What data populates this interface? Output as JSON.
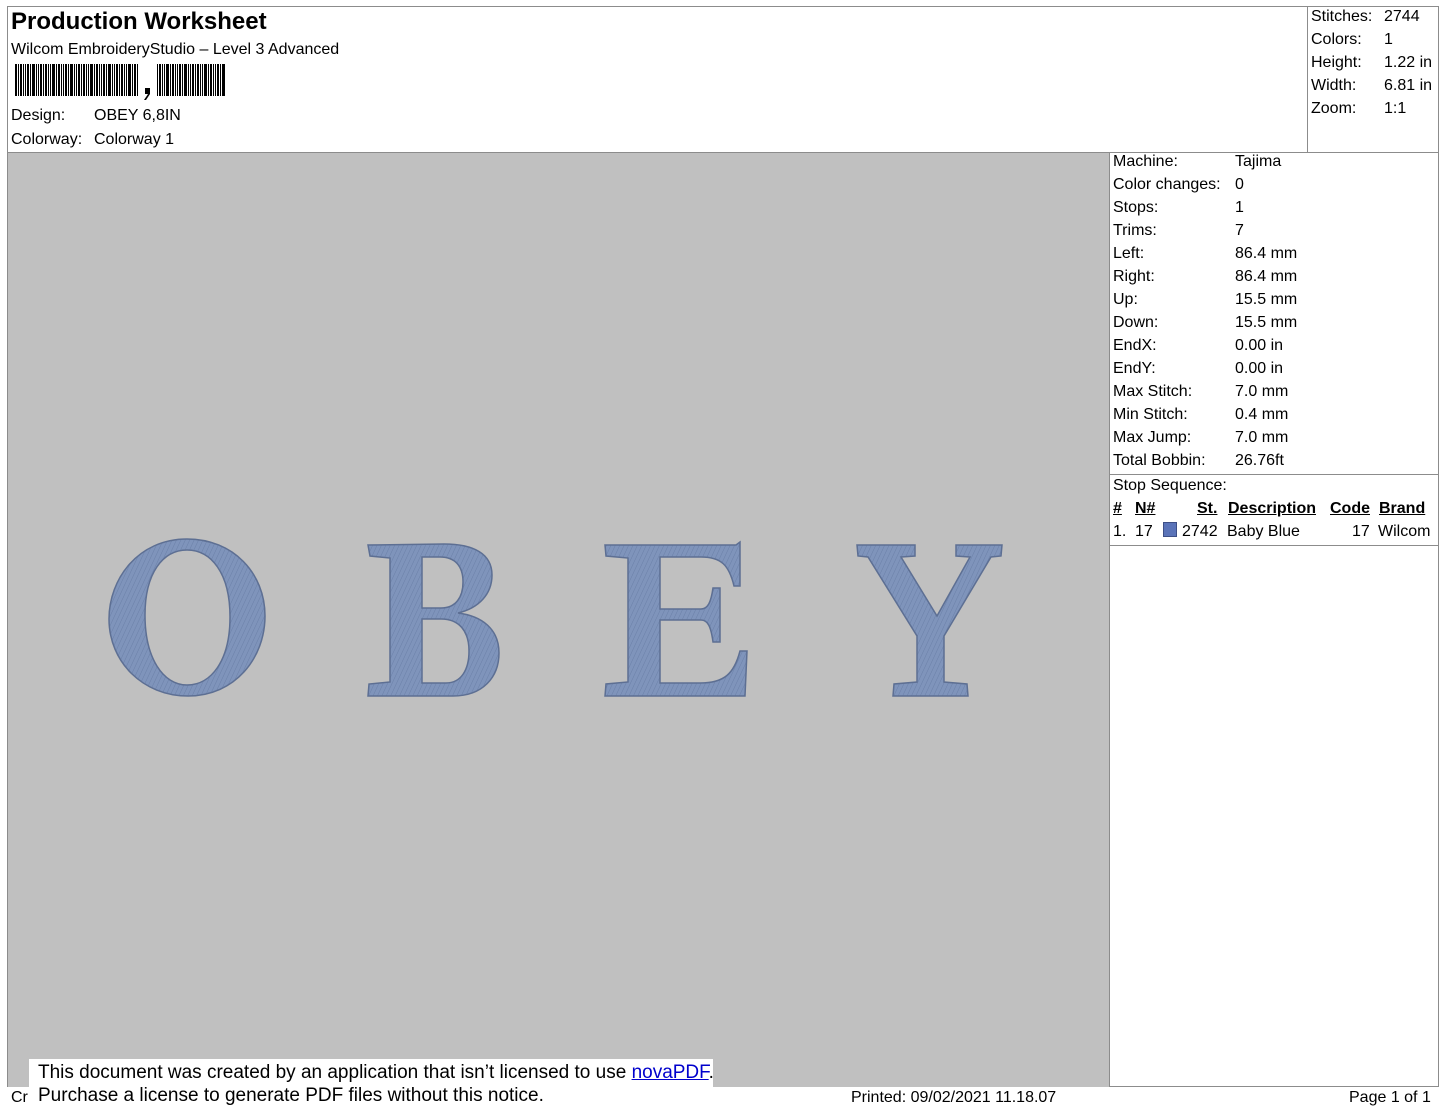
{
  "header": {
    "title": "Production Worksheet",
    "subtitle": "Wilcom EmbroideryStudio – Level 3 Advanced",
    "design_label": "Design:",
    "design_value": "OBEY 6,8IN",
    "colorway_label": "Colorway:",
    "colorway_value": "Colorway 1"
  },
  "summary": [
    {
      "label": "Stitches:",
      "value": "2744"
    },
    {
      "label": "Colors:",
      "value": "1"
    },
    {
      "label": "Height:",
      "value": "1.22 in"
    },
    {
      "label": "Width:",
      "value": "6.81 in"
    },
    {
      "label": "Zoom:",
      "value": "1:1"
    }
  ],
  "machine_info": [
    {
      "label": "Machine:",
      "value": "Tajima"
    },
    {
      "label": "Color changes:",
      "value": "0"
    },
    {
      "label": "Stops:",
      "value": "1"
    },
    {
      "label": "Trims:",
      "value": "7"
    },
    {
      "label": "Left:",
      "value": "86.4 mm"
    },
    {
      "label": "Right:",
      "value": "86.4 mm"
    },
    {
      "label": "Up:",
      "value": "15.5 mm"
    },
    {
      "label": "Down:",
      "value": "15.5 mm"
    },
    {
      "label": "EndX:",
      "value": "0.00 in"
    },
    {
      "label": "EndY:",
      "value": "0.00 in"
    },
    {
      "label": "Max Stitch:",
      "value": "7.0 mm"
    },
    {
      "label": "Min Stitch:",
      "value": "0.4 mm"
    },
    {
      "label": "Max Jump:",
      "value": "7.0 mm"
    },
    {
      "label": "Total Bobbin:",
      "value": "26.76ft"
    }
  ],
  "stop_sequence": {
    "title": "Stop Sequence:",
    "columns": [
      "#",
      "N#",
      "St.",
      "Description",
      "Code",
      "Brand"
    ],
    "rows": [
      {
        "index": "1.",
        "needle": "17",
        "stitches": "2742",
        "description": "Baby Blue",
        "code": "17",
        "brand": "Wilcom",
        "color": "#5a73b8"
      }
    ]
  },
  "design_preview": {
    "letters": [
      "O",
      "B",
      "E",
      "Y"
    ],
    "thread_color": "#7f94bb",
    "background_color": "#c0c0c0"
  },
  "notice": {
    "line1_prefix": "This document was created by an application that isn’t licensed to use ",
    "link_text": "novaPDF",
    "line1_suffix": ".",
    "line2": "Purchase a license to generate PDF files without this notice."
  },
  "footer": {
    "left": "Cr",
    "printed": "Printed: 09/02/2021 11.18.07",
    "page": "Page 1 of 1"
  }
}
